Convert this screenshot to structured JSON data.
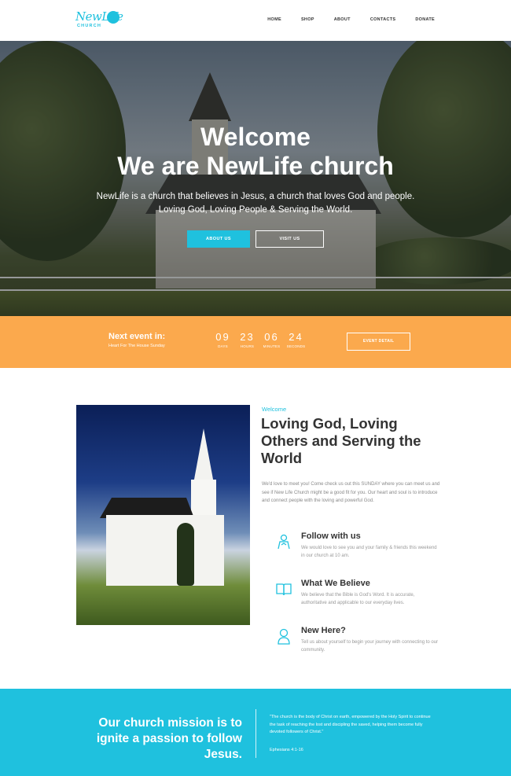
{
  "header": {
    "logo_script": "NewLife",
    "logo_sub": "CHURCH",
    "nav": [
      "HOME",
      "SHOP",
      "ABOUT",
      "CONTACTS",
      "DONATE"
    ]
  },
  "hero": {
    "title_line1": "Welcome",
    "title_line2": "We are NewLife church",
    "text_line1": "NewLife is a church that believes in Jesus, a church that loves God and people.",
    "text_line2": "Loving God, Loving People & Serving the World.",
    "btn_about": "ABOUT US",
    "btn_visit": "VISIT US"
  },
  "event": {
    "title": "Next event in:",
    "subtitle": "Heart For The House Sunday",
    "countdown": [
      {
        "value": "09",
        "label": "DAYS"
      },
      {
        "value": "23",
        "label": "HOURS"
      },
      {
        "value": "06",
        "label": "MINUTES"
      },
      {
        "value": "24",
        "label": "SECONDS"
      }
    ],
    "button": "EVENT DETAIL"
  },
  "about": {
    "kicker": "Welcome",
    "title": "Loving God, Loving Others and Serving the World",
    "text": "We'd love to meet you! Come check us out this SUNDAY where you can meet us and see if New Life Church might be a good fit for you. Our heart and soul is to introduce and connect people with the loving and powerful God.",
    "features": [
      {
        "icon": "person-icon",
        "title": "Follow with us",
        "text": "We would love to see you and your family & friends this weekend in our church at 10 am."
      },
      {
        "icon": "book-icon",
        "title": "What We Believe",
        "text": "We believe that the Bible is God's Word. It is accurate, authoritative and applicable to our everyday lives."
      },
      {
        "icon": "user-icon",
        "title": "New Here?",
        "text": "Tell us about yourself to begin your journey with connecting to our community."
      }
    ]
  },
  "mission": {
    "title": "Our church mission is to ignite a passion to follow Jesus.",
    "quote": "\"The church is the body of Christ on earth, empowered by the Holy Spirit to continue the task of reaching the lost and discipling the saved, helping them become fully devoted followers of Christ.\"",
    "ref": "Ephesians 4:1-16"
  },
  "colors": {
    "accent": "#1fc1de",
    "event": "#fba94d"
  }
}
